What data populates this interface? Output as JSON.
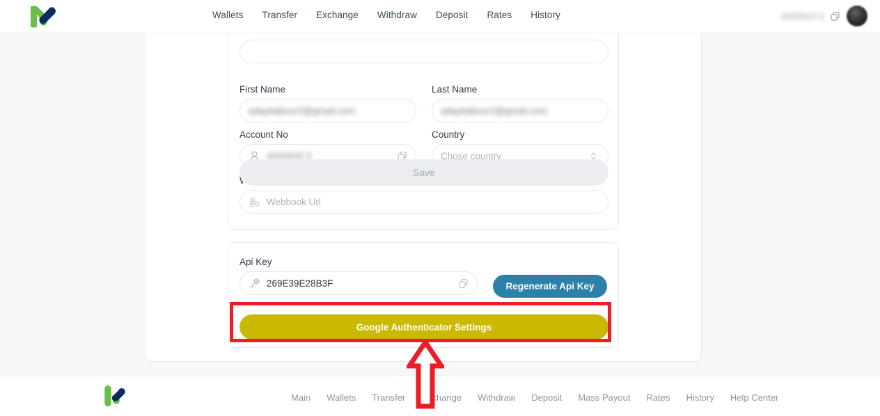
{
  "header": {
    "logo_icon": "kuna-k-logo-icon",
    "nav": [
      {
        "label": "Wallets"
      },
      {
        "label": "Transfer"
      },
      {
        "label": "Exchange"
      },
      {
        "label": "Withdraw"
      },
      {
        "label": "Deposit"
      },
      {
        "label": "Rates"
      },
      {
        "label": "History"
      }
    ],
    "account_no": "4202915 3",
    "copy_icon": "copy-icon",
    "avatar_icon": "user-avatar"
  },
  "profile_card": {
    "first_name": {
      "label": "First Name",
      "value": "adaybakour2@gmail.com"
    },
    "last_name": {
      "label": "Last Name",
      "value": "adaybakour2@gmail.com"
    },
    "account_no": {
      "label": "Account No",
      "value": "4202915 3",
      "lead_icon": "user-icon",
      "trail_icon": "copy-icon"
    },
    "country": {
      "label": "Country",
      "placeholder": "Chose country",
      "trail_icon": "chevron-updown-icon"
    },
    "webhook": {
      "label": "Webhook Url",
      "placeholder": "Webhook Url",
      "lead_icon": "webhook-icon"
    },
    "save_label": "Save"
  },
  "api_card": {
    "api_key": {
      "label": "Api Key",
      "value": "269E39E28B3F",
      "lead_icon": "key-icon",
      "trail_icon": "copy-icon"
    },
    "regenerate_label": "Regenerate Api Key",
    "google_auth_label": "Google Authenticator Settings"
  },
  "footer": {
    "logo_icon": "kuna-k-logo-icon",
    "nav": [
      {
        "label": "Main"
      },
      {
        "label": "Wallets"
      },
      {
        "label": "Transfer"
      },
      {
        "label": "Exchange"
      },
      {
        "label": "Withdraw"
      },
      {
        "label": "Deposit"
      },
      {
        "label": "Mass Payout"
      },
      {
        "label": "Rates"
      },
      {
        "label": "History"
      },
      {
        "label": "Help Center"
      }
    ]
  },
  "annotation": {
    "color": "#ee1c24",
    "highlight_target": "google-authenticator-settings-button",
    "arrow_direction": "up"
  },
  "colors": {
    "accent_teal": "#2b81a8",
    "accent_gold": "#cbb800",
    "logo_green": "#6abf4b",
    "logo_navy": "#0d2d5e",
    "annotation_red": "#ee1c24"
  }
}
